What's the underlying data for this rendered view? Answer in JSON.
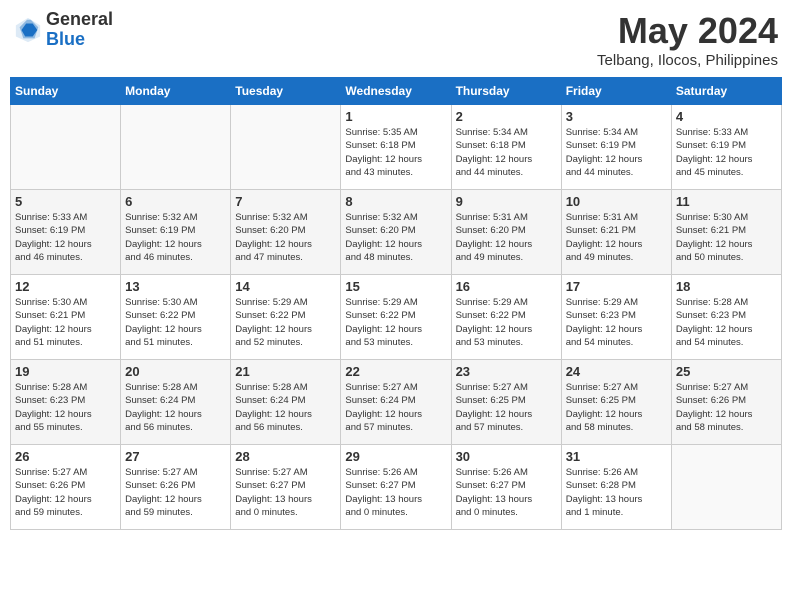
{
  "header": {
    "logo_general": "General",
    "logo_blue": "Blue",
    "month_title": "May 2024",
    "location": "Telbang, Ilocos, Philippines"
  },
  "days_of_week": [
    "Sunday",
    "Monday",
    "Tuesday",
    "Wednesday",
    "Thursday",
    "Friday",
    "Saturday"
  ],
  "weeks": [
    [
      {
        "day": "",
        "info": ""
      },
      {
        "day": "",
        "info": ""
      },
      {
        "day": "",
        "info": ""
      },
      {
        "day": "1",
        "info": "Sunrise: 5:35 AM\nSunset: 6:18 PM\nDaylight: 12 hours\nand 43 minutes."
      },
      {
        "day": "2",
        "info": "Sunrise: 5:34 AM\nSunset: 6:18 PM\nDaylight: 12 hours\nand 44 minutes."
      },
      {
        "day": "3",
        "info": "Sunrise: 5:34 AM\nSunset: 6:19 PM\nDaylight: 12 hours\nand 44 minutes."
      },
      {
        "day": "4",
        "info": "Sunrise: 5:33 AM\nSunset: 6:19 PM\nDaylight: 12 hours\nand 45 minutes."
      }
    ],
    [
      {
        "day": "5",
        "info": "Sunrise: 5:33 AM\nSunset: 6:19 PM\nDaylight: 12 hours\nand 46 minutes."
      },
      {
        "day": "6",
        "info": "Sunrise: 5:32 AM\nSunset: 6:19 PM\nDaylight: 12 hours\nand 46 minutes."
      },
      {
        "day": "7",
        "info": "Sunrise: 5:32 AM\nSunset: 6:20 PM\nDaylight: 12 hours\nand 47 minutes."
      },
      {
        "day": "8",
        "info": "Sunrise: 5:32 AM\nSunset: 6:20 PM\nDaylight: 12 hours\nand 48 minutes."
      },
      {
        "day": "9",
        "info": "Sunrise: 5:31 AM\nSunset: 6:20 PM\nDaylight: 12 hours\nand 49 minutes."
      },
      {
        "day": "10",
        "info": "Sunrise: 5:31 AM\nSunset: 6:21 PM\nDaylight: 12 hours\nand 49 minutes."
      },
      {
        "day": "11",
        "info": "Sunrise: 5:30 AM\nSunset: 6:21 PM\nDaylight: 12 hours\nand 50 minutes."
      }
    ],
    [
      {
        "day": "12",
        "info": "Sunrise: 5:30 AM\nSunset: 6:21 PM\nDaylight: 12 hours\nand 51 minutes."
      },
      {
        "day": "13",
        "info": "Sunrise: 5:30 AM\nSunset: 6:22 PM\nDaylight: 12 hours\nand 51 minutes."
      },
      {
        "day": "14",
        "info": "Sunrise: 5:29 AM\nSunset: 6:22 PM\nDaylight: 12 hours\nand 52 minutes."
      },
      {
        "day": "15",
        "info": "Sunrise: 5:29 AM\nSunset: 6:22 PM\nDaylight: 12 hours\nand 53 minutes."
      },
      {
        "day": "16",
        "info": "Sunrise: 5:29 AM\nSunset: 6:22 PM\nDaylight: 12 hours\nand 53 minutes."
      },
      {
        "day": "17",
        "info": "Sunrise: 5:29 AM\nSunset: 6:23 PM\nDaylight: 12 hours\nand 54 minutes."
      },
      {
        "day": "18",
        "info": "Sunrise: 5:28 AM\nSunset: 6:23 PM\nDaylight: 12 hours\nand 54 minutes."
      }
    ],
    [
      {
        "day": "19",
        "info": "Sunrise: 5:28 AM\nSunset: 6:23 PM\nDaylight: 12 hours\nand 55 minutes."
      },
      {
        "day": "20",
        "info": "Sunrise: 5:28 AM\nSunset: 6:24 PM\nDaylight: 12 hours\nand 56 minutes."
      },
      {
        "day": "21",
        "info": "Sunrise: 5:28 AM\nSunset: 6:24 PM\nDaylight: 12 hours\nand 56 minutes."
      },
      {
        "day": "22",
        "info": "Sunrise: 5:27 AM\nSunset: 6:24 PM\nDaylight: 12 hours\nand 57 minutes."
      },
      {
        "day": "23",
        "info": "Sunrise: 5:27 AM\nSunset: 6:25 PM\nDaylight: 12 hours\nand 57 minutes."
      },
      {
        "day": "24",
        "info": "Sunrise: 5:27 AM\nSunset: 6:25 PM\nDaylight: 12 hours\nand 58 minutes."
      },
      {
        "day": "25",
        "info": "Sunrise: 5:27 AM\nSunset: 6:26 PM\nDaylight: 12 hours\nand 58 minutes."
      }
    ],
    [
      {
        "day": "26",
        "info": "Sunrise: 5:27 AM\nSunset: 6:26 PM\nDaylight: 12 hours\nand 59 minutes."
      },
      {
        "day": "27",
        "info": "Sunrise: 5:27 AM\nSunset: 6:26 PM\nDaylight: 12 hours\nand 59 minutes."
      },
      {
        "day": "28",
        "info": "Sunrise: 5:27 AM\nSunset: 6:27 PM\nDaylight: 13 hours\nand 0 minutes."
      },
      {
        "day": "29",
        "info": "Sunrise: 5:26 AM\nSunset: 6:27 PM\nDaylight: 13 hours\nand 0 minutes."
      },
      {
        "day": "30",
        "info": "Sunrise: 5:26 AM\nSunset: 6:27 PM\nDaylight: 13 hours\nand 0 minutes."
      },
      {
        "day": "31",
        "info": "Sunrise: 5:26 AM\nSunset: 6:28 PM\nDaylight: 13 hours\nand 1 minute."
      },
      {
        "day": "",
        "info": ""
      }
    ]
  ]
}
